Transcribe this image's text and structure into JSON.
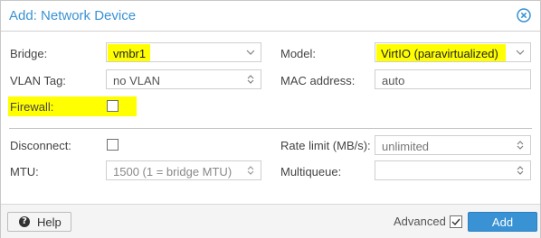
{
  "dialog": {
    "title": "Add: Network Device",
    "close_icon": "close-circle-icon"
  },
  "form": {
    "bridge": {
      "label": "Bridge:",
      "value": "vmbr1",
      "highlighted": true
    },
    "model": {
      "label": "Model:",
      "value": "VirtIO (paravirtualized)",
      "highlighted": true
    },
    "vlan_tag": {
      "label": "VLAN Tag:",
      "value": "no VLAN"
    },
    "mac_address": {
      "label": "MAC address:",
      "value": "auto"
    },
    "firewall": {
      "label": "Firewall:",
      "checked": false,
      "highlighted": true
    },
    "disconnect": {
      "label": "Disconnect:",
      "checked": false
    },
    "rate_limit": {
      "label": "Rate limit (MB/s):",
      "value": "unlimited"
    },
    "mtu": {
      "label": "MTU:",
      "value": "1500 (1 = bridge MTU)",
      "disabled": true
    },
    "multiqueue": {
      "label": "Multiqueue:",
      "value": ""
    }
  },
  "footer": {
    "help_label": "Help",
    "help_icon": "question-circle-icon",
    "advanced_label": "Advanced",
    "advanced_checked": true,
    "add_label": "Add"
  },
  "colors": {
    "accent": "#3892d4",
    "highlight": "#ffff00",
    "footer_bg": "#f4f4f4"
  }
}
